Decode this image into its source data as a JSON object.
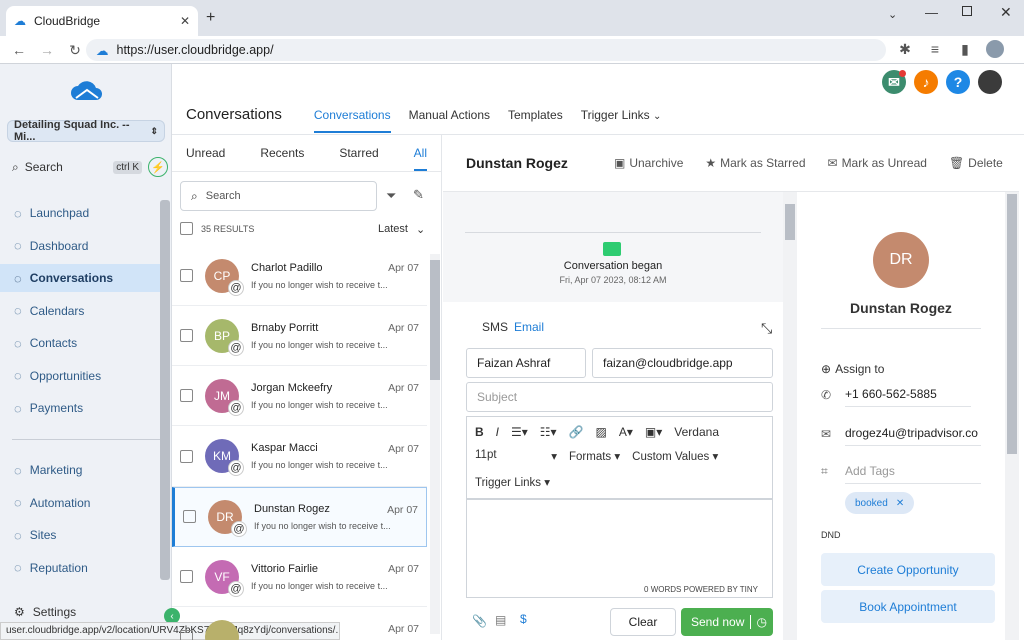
{
  "browser": {
    "tab_title": "CloudBridge",
    "url": "https://user.cloudbridge.app/",
    "status_url": "user.cloudbridge.app/v2/location/URV4ZbKS75q6XJq8zYdj/conversations/.../l..."
  },
  "sidebar": {
    "org": "Detailing Squad Inc. -- Mi...",
    "search": "Search",
    "shortcut": "ctrl K",
    "items": [
      {
        "label": "Launchpad",
        "icon": "rocket-icon"
      },
      {
        "label": "Dashboard",
        "icon": "grid-icon"
      },
      {
        "label": "Conversations",
        "icon": "chat-icon"
      },
      {
        "label": "Calendars",
        "icon": "calendar-icon"
      },
      {
        "label": "Contacts",
        "icon": "contacts-icon"
      },
      {
        "label": "Opportunities",
        "icon": "funnel-icon"
      },
      {
        "label": "Payments",
        "icon": "payments-icon"
      }
    ],
    "items2": [
      {
        "label": "Marketing",
        "icon": "send-icon"
      },
      {
        "label": "Automation",
        "icon": "automation-icon"
      },
      {
        "label": "Sites",
        "icon": "sites-icon"
      },
      {
        "label": "Reputation",
        "icon": "star-icon"
      }
    ],
    "settings": "Settings"
  },
  "header": {
    "title": "Conversations",
    "tabs": [
      "Conversations",
      "Manual Actions",
      "Templates",
      "Trigger Links"
    ]
  },
  "list": {
    "filters": [
      "Unread",
      "Recents",
      "Starred",
      "All"
    ],
    "search_placeholder": "Search",
    "results": "35 RESULTS",
    "sort": "Latest",
    "rows": [
      {
        "initials": "CP",
        "name": "Charlot Padillo",
        "date": "Apr 07",
        "snippet": "If you no longer wish to receive t...",
        "color": "#c48a6e"
      },
      {
        "initials": "BP",
        "name": "Brnaby Porritt",
        "date": "Apr 07",
        "snippet": "If you no longer wish to receive t...",
        "color": "#a6b86b"
      },
      {
        "initials": "JM",
        "name": "Jorgan Mckeefry",
        "date": "Apr 07",
        "snippet": "If you no longer wish to receive t...",
        "color": "#c06b93"
      },
      {
        "initials": "KM",
        "name": "Kaspar Macci",
        "date": "Apr 07",
        "snippet": "If you no longer wish to receive t...",
        "color": "#6f6bb8"
      },
      {
        "initials": "DR",
        "name": "Dunstan Rogez",
        "date": "Apr 07",
        "snippet": "If you no longer wish to receive t...",
        "color": "#c48a6e"
      },
      {
        "initials": "VF",
        "name": "Vittorio Fairlie",
        "date": "Apr 07",
        "snippet": "If you no longer wish to receive t...",
        "color": "#c46bb3"
      },
      {
        "initials": "",
        "name": "",
        "date": "Apr 07",
        "snippet": "",
        "color": "#b8b06b"
      }
    ]
  },
  "conversation": {
    "name": "Dunstan Rogez",
    "actions": [
      "Unarchive",
      "Mark as Starred",
      "Mark as Unread",
      "Delete"
    ],
    "began": "Conversation began",
    "began_time": "Fri, Apr 07 2023, 08:12 AM",
    "compose": {
      "tabs": [
        "SMS",
        "Email"
      ],
      "from_name": "Faizan Ashraf",
      "from_email": "faizan@cloudbridge.app",
      "subject_placeholder": "Subject",
      "font": "Verdana",
      "size": "11pt",
      "formats": "Formats",
      "custom": "Custom Values",
      "trigger": "Trigger Links",
      "words": "0 WORDS POWERED BY TINY",
      "clear": "Clear",
      "send": "Send now"
    }
  },
  "contact": {
    "initials": "DR",
    "name": "Dunstan Rogez",
    "assign": "Assign to",
    "phone": "+1 660-562-5885",
    "email": "drogez4u@tripadvisor.co",
    "tags_placeholder": "Add Tags",
    "tag": "booked",
    "dnd": "DND",
    "create": "Create Opportunity",
    "book": "Book Appointment"
  },
  "colors": {
    "accent": "#1e7dd6",
    "send": "#4caf50"
  }
}
